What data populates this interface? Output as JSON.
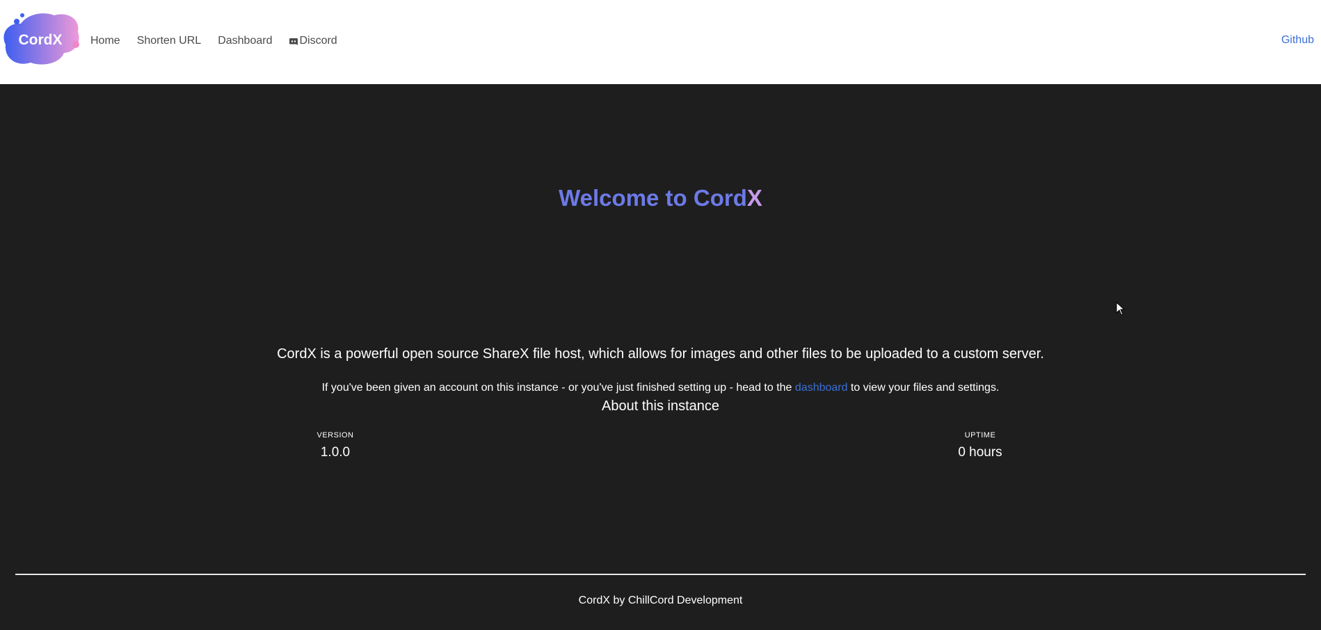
{
  "brand": {
    "logo_text": "CordX"
  },
  "nav": {
    "items": [
      {
        "label": "Home"
      },
      {
        "label": "Shorten URL"
      },
      {
        "label": "Dashboard"
      },
      {
        "label": "Discord",
        "icon": "discord-icon"
      }
    ],
    "right_link": "Github"
  },
  "hero": {
    "title_main": "Welcome to Cord",
    "title_accent": "X"
  },
  "content": {
    "lead": "CordX is a powerful open source ShareX file host, which allows for images and other files to be uploaded to a custom server.",
    "sub_before": "If you've been given an account on this instance - or you've just finished setting up - head to the ",
    "sub_link": "dashboard",
    "sub_after": " to view your files and settings."
  },
  "about": {
    "title": "About this instance",
    "version_label": "VERSION",
    "version_value": "1.0.0",
    "uptime_label": "UPTIME",
    "uptime_value": "0 hours"
  },
  "footer": {
    "text": "CordX by ChillCord Development"
  },
  "colors": {
    "background": "#1e1e1e",
    "navbar": "#ffffff",
    "link": "#3b6fd4",
    "title": "#6d7ae8",
    "title_accent": "#c79be9"
  }
}
